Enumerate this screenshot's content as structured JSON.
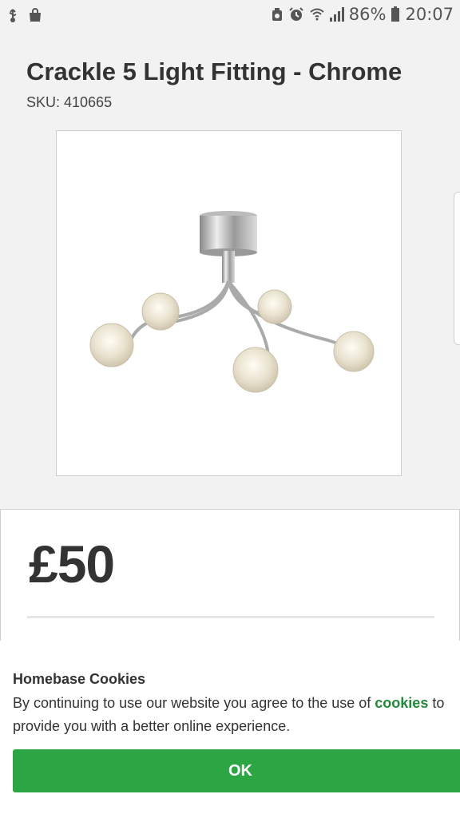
{
  "statusbar": {
    "battery_percent": "86%",
    "time": "20:07",
    "icons": [
      "usb-icon",
      "shopping-bag-icon",
      "recycle-icon",
      "alarm-icon",
      "wifi-icon",
      "signal-icon",
      "battery-icon"
    ]
  },
  "product": {
    "title": "Crackle 5 Light Fitting - Chrome",
    "sku": "SKU: 410665",
    "price": "£50"
  },
  "cookie_banner": {
    "title": "Homebase Cookies",
    "text_before": "By continuing to use our website you agree to the use of ",
    "link_text": "cookies",
    "text_after": " to provide you with a better online experience.",
    "ok_label": "OK"
  },
  "colors": {
    "accent": "#2ca543",
    "link": "#218a3a",
    "background": "#f2f2f2"
  }
}
